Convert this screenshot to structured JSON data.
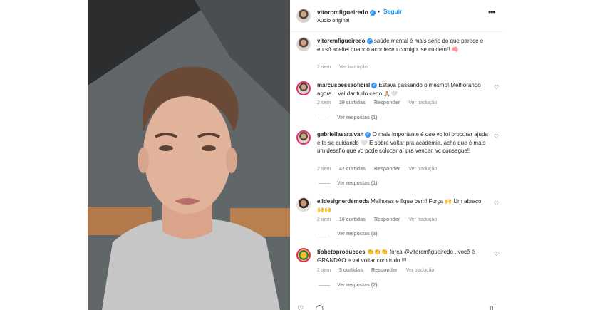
{
  "post": {
    "author": "vitorcmfigueiredo",
    "follow_label": "Seguir",
    "audio_label": "Áudio original",
    "more_label": "•••"
  },
  "caption": {
    "username": "vitorcmfigueiredo",
    "text": " saúde mental é mais sério do que parece e eu só aceitei quando aconteceu comigo. se cuidem!! 🧠",
    "time": "2 sem",
    "translate": "Ver tradução"
  },
  "comments": [
    {
      "username": "marcusbessaoficial",
      "verified": true,
      "text": " Estava passando o mesmo! Melhorando agora... vai dar tudo certo 🙏🏼🤍",
      "time": "2 sem",
      "likes": "29 curtidas",
      "reply": "Responder",
      "translate": "Ver tradução",
      "view_replies": "Ver respostas (1)"
    },
    {
      "username": "gabriellasaraivah",
      "verified": true,
      "text": " O mais importante é que vc foi procurar ajuda e ta se cuidando 🤍 E sobre voltar pra academia, acho que é mais um desafio que vc pode colocar aí pra vencer, vc consegue!!",
      "time": "2 sem",
      "likes": "42 curtidas",
      "reply": "Responder",
      "translate": "Ver tradução",
      "view_replies": "Ver respostas (1)"
    },
    {
      "username": "elidesignerdemoda",
      "verified": false,
      "text": " Melhoras e fique bem! Força 🙌 Um abraço 🙌🙌",
      "time": "2 sem",
      "likes": "10 curtidas",
      "reply": "Responder",
      "translate": "Ver tradução",
      "view_replies": "Ver respostas (3)"
    },
    {
      "username": "tiobetoproducoes",
      "verified": false,
      "text": " 👏👏👏 força @vitorcmfigueiredo , você é GRANDAO e vai voltar com tudo !!!",
      "time": "2 sem",
      "likes": "5 curtidas",
      "reply": "Responder",
      "translate": "Ver tradução",
      "view_replies": "Ver respostas (2)"
    }
  ],
  "icons": [
    "heart-icon",
    "comment-icon",
    "share-icon",
    "bookmark-icon",
    "more-icon"
  ],
  "colors": {
    "link": "#0095f6",
    "verified": "#3897f0",
    "muted": "#8e8e8e",
    "story_ring": "#e1306c"
  }
}
